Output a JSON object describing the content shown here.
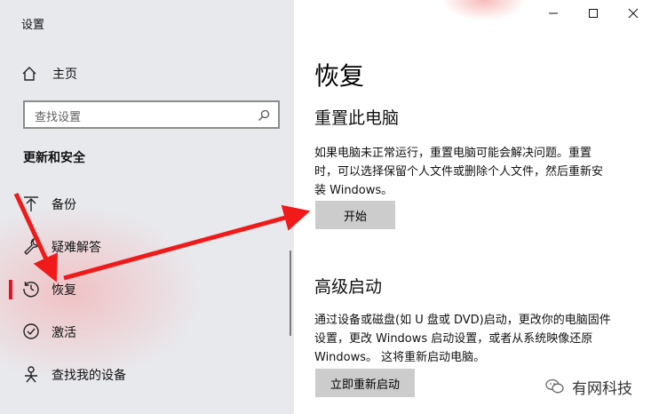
{
  "window": {
    "app_title": "设置",
    "controls": {
      "minimize": "minimize-icon",
      "maximize": "maximize-icon",
      "close": "close-icon"
    }
  },
  "sidebar": {
    "home_label": "主页",
    "search_placeholder": "查找设置",
    "section_title": "更新和安全",
    "items": [
      {
        "label": "备份",
        "icon": "backup-icon"
      },
      {
        "label": "疑难解答",
        "icon": "wrench-icon"
      },
      {
        "label": "恢复",
        "icon": "history-icon",
        "selected": true
      },
      {
        "label": "激活",
        "icon": "check-circle-icon"
      },
      {
        "label": "查找我的设备",
        "icon": "person-locate-icon"
      }
    ]
  },
  "main": {
    "title": "恢复",
    "reset": {
      "heading": "重置此电脑",
      "desc_line1": "如果电脑未正常运行，重置电脑可能会解决问题。重置",
      "desc_line2": "时，可以选择保留个人文件或删除个人文件，然后重新安",
      "desc_line3": "装 Windows。",
      "button": "开始"
    },
    "advanced": {
      "heading": "高级启动",
      "desc_line1": "通过设备或磁盘(如 U 盘或 DVD)启动，更改你的电脑固件",
      "desc_line2": "设置，更改 Windows 启动设置，或者从系统映像还原",
      "desc_line3": "Windows。 这将重新启动电脑。",
      "button": "立即重新启动"
    }
  },
  "watermark": {
    "text": "有网科技",
    "icon": "wechat-icon"
  },
  "colors": {
    "accent_red": "#e81123",
    "annotation_arrow": "#f01a1a",
    "sidebar_bg": "#e8e9ed",
    "button_bg": "#cccccc"
  }
}
